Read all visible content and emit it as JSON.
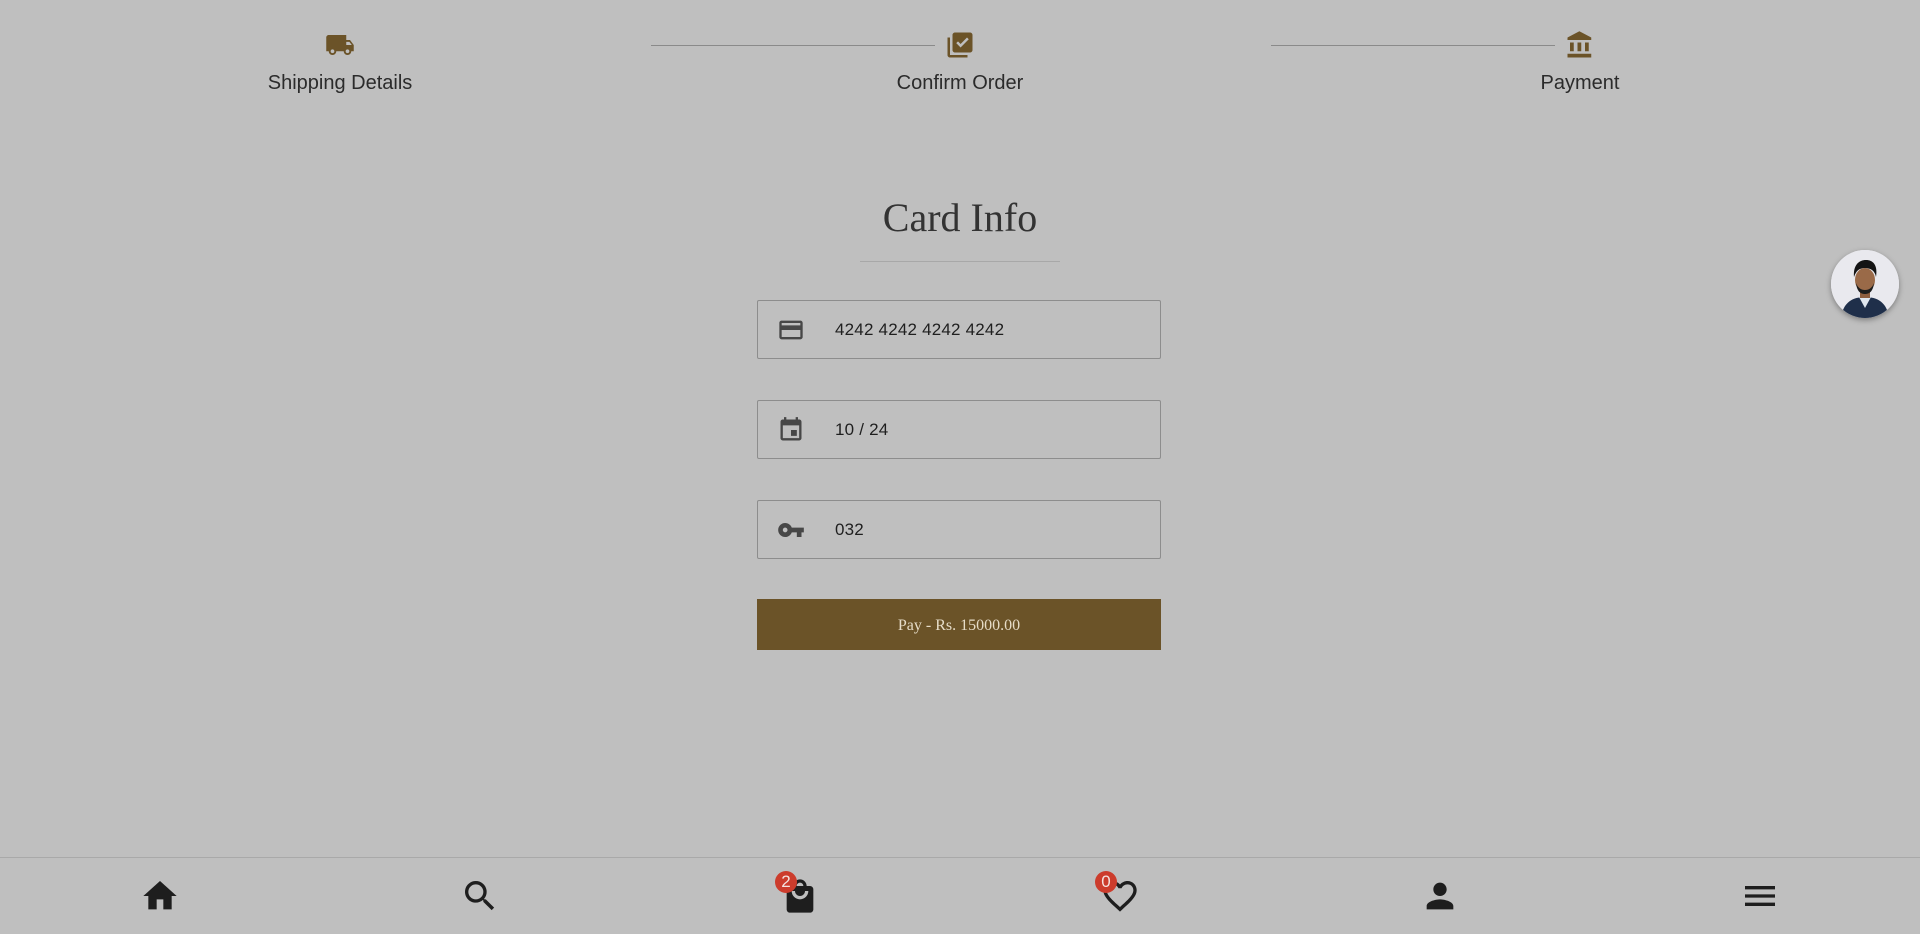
{
  "stepper": {
    "steps": [
      {
        "label": "Shipping Details",
        "icon": "truck-icon"
      },
      {
        "label": "Confirm Order",
        "icon": "checklist-icon"
      },
      {
        "label": "Payment",
        "icon": "bank-icon"
      }
    ],
    "active_color": "#6b5328"
  },
  "card_info": {
    "title": "Card Info",
    "card_number": {
      "value": "4242 4242 4242 4242",
      "icon": "credit-card-icon"
    },
    "expiry": {
      "value": "10 / 24",
      "icon": "calendar-icon"
    },
    "cvc": {
      "value": "032",
      "icon": "key-icon"
    },
    "pay_button_label": "Pay - Rs. 15000.00",
    "button_color": "#6b5328"
  },
  "bottom_nav": {
    "items": [
      {
        "name": "home",
        "icon": "home-icon"
      },
      {
        "name": "search",
        "icon": "search-icon"
      },
      {
        "name": "cart",
        "icon": "shopping-bag-icon",
        "badge": "2"
      },
      {
        "name": "wishlist",
        "icon": "heart-icon",
        "badge": "0"
      },
      {
        "name": "account",
        "icon": "person-icon"
      },
      {
        "name": "menu",
        "icon": "menu-icon"
      }
    ],
    "badge_color": "#cc3c2c"
  }
}
